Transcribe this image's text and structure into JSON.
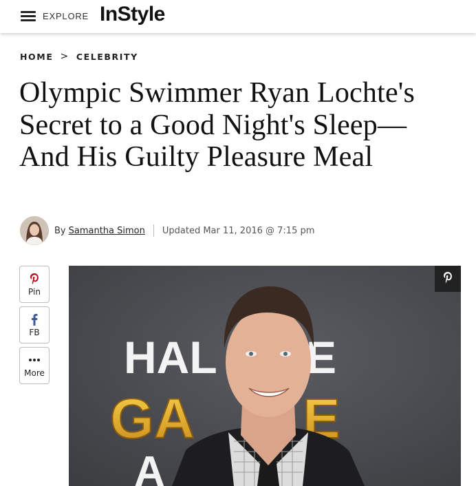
{
  "header": {
    "explore_label": "EXPLORE",
    "logo_text": "InStyle"
  },
  "breadcrumb": {
    "items": [
      "HOME",
      "CELEBRITY"
    ],
    "separator": ">"
  },
  "article": {
    "title": "Olympic Swimmer Ryan Lochte's Secret to a Good Night's Sleep—And His Guilty Pleasure Meal",
    "byline_prefix": "By",
    "author": "Samantha Simon",
    "updated": "Updated Mar 11, 2016 @ 7:15 pm"
  },
  "share": {
    "buttons": [
      {
        "label": "Pin",
        "icon": "pinterest-icon",
        "color": "#bd081c"
      },
      {
        "label": "FB",
        "icon": "facebook-icon",
        "color": "#3b5998"
      },
      {
        "label": "More",
        "icon": "more-dots-icon",
        "color": "#222222"
      }
    ]
  },
  "hero": {
    "backdrop_text_line1": "HAL",
    "backdrop_text_line2": "GA",
    "backdrop_text_line3": "A",
    "pin_icon": "pinterest-icon"
  }
}
